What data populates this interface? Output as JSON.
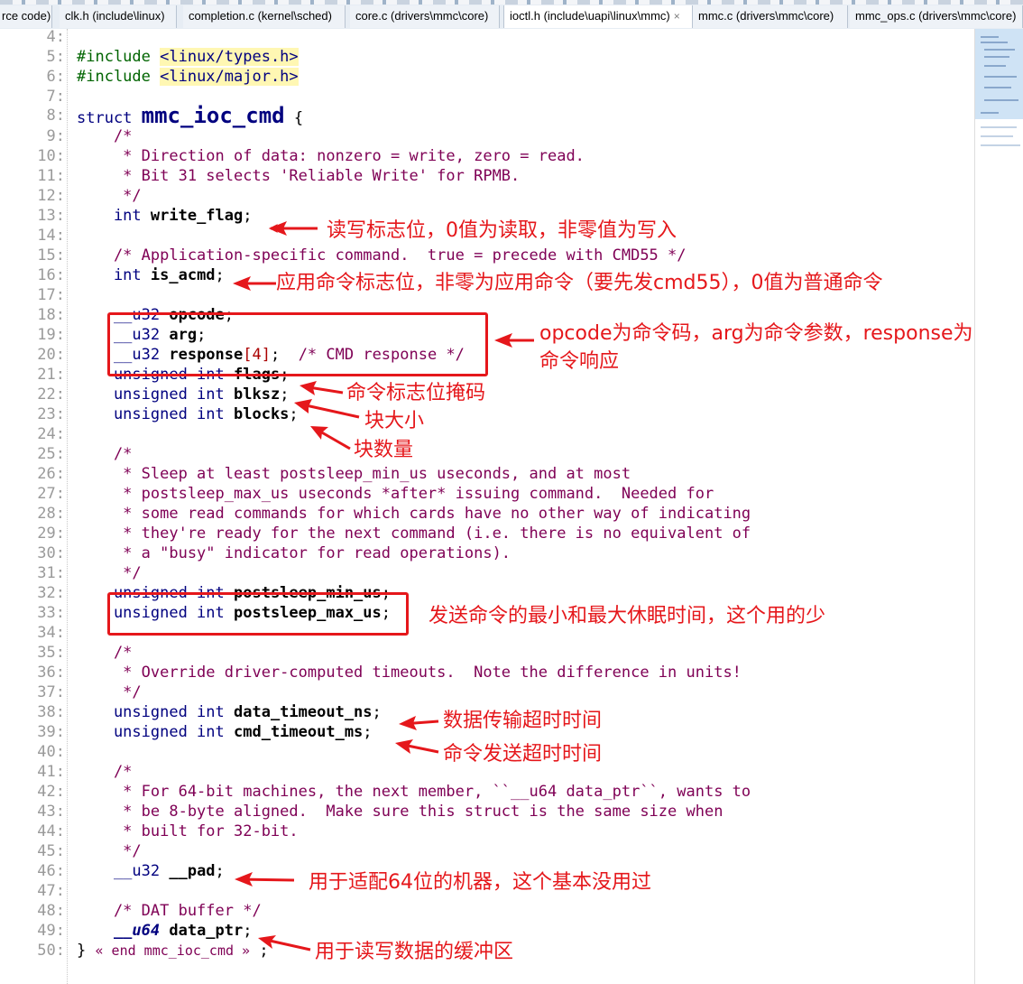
{
  "tabs": [
    {
      "label": "rce code)"
    },
    {
      "label": "clk.h (include\\linux)"
    },
    {
      "label": "completion.c (kernel\\sched)"
    },
    {
      "label": "core.c (drivers\\mmc\\core)"
    },
    {
      "label": "ioctl.h (include\\uapi\\linux\\mmc)",
      "active": true,
      "close": "×"
    },
    {
      "label": "mmc.c (drivers\\mmc\\core)"
    },
    {
      "label": "mmc_ops.c (drivers\\mmc\\core)"
    }
  ],
  "code": {
    "lines": [
      {
        "n": "4:"
      },
      {
        "n": "5:",
        "pp": "#include ",
        "inc": "<linux/types.h>"
      },
      {
        "n": "6:",
        "pp": "#include ",
        "inc": "<linux/major.h>"
      },
      {
        "n": "7:"
      },
      {
        "n": "8:",
        "kw": "struct ",
        "sname": "mmc_ioc_cmd",
        "rest": " {"
      },
      {
        "n": "9:",
        "cm": "    /*"
      },
      {
        "n": "10:",
        "cm": "     * Direction of data: nonzero = write, zero = read."
      },
      {
        "n": "11:",
        "cm": "     * Bit 31 selects 'Reliable Write' for RPMB."
      },
      {
        "n": "12:",
        "cm": "     */"
      },
      {
        "n": "13:",
        "ty": "    int ",
        "bd": "write_flag",
        "rest": ";"
      },
      {
        "n": "14:"
      },
      {
        "n": "15:",
        "cm": "    /* Application-specific command.  true = precede with CMD55 */"
      },
      {
        "n": "16:",
        "ty": "    int ",
        "bd": "is_acmd",
        "rest": ";"
      },
      {
        "n": "17:"
      },
      {
        "n": "18:",
        "ty": "    __u32 ",
        "bd": "opcode",
        "rest": ";"
      },
      {
        "n": "19:",
        "ty": "    __u32 ",
        "bd": "arg",
        "rest": ";"
      },
      {
        "n": "20:",
        "ty": "    __u32 ",
        "bd": "response",
        "nm": "[4]",
        "rest": ";  ",
        "cm2": "/* CMD response */"
      },
      {
        "n": "21:",
        "ty": "    unsigned int ",
        "bd": "flags",
        "rest": ";"
      },
      {
        "n": "22:",
        "ty": "    unsigned int ",
        "bd": "blksz",
        "rest": ";"
      },
      {
        "n": "23:",
        "ty": "    unsigned int ",
        "bd": "blocks",
        "rest": ";"
      },
      {
        "n": "24:"
      },
      {
        "n": "25:",
        "cm": "    /*"
      },
      {
        "n": "26:",
        "cm": "     * Sleep at least postsleep_min_us useconds, and at most"
      },
      {
        "n": "27:",
        "cm": "     * postsleep_max_us useconds *after* issuing command.  Needed for"
      },
      {
        "n": "28:",
        "cm": "     * some read commands for which cards have no other way of indicating"
      },
      {
        "n": "29:",
        "cm": "     * they're ready for the next command (i.e. there is no equivalent of"
      },
      {
        "n": "30:",
        "cm": "     * a \"busy\" indicator for read operations)."
      },
      {
        "n": "31:",
        "cm": "     */"
      },
      {
        "n": "32:",
        "ty": "    unsigned int ",
        "bd": "postsleep_min_us",
        "rest": ";"
      },
      {
        "n": "33:",
        "ty": "    unsigned int ",
        "bd": "postsleep_max_us",
        "rest": ";"
      },
      {
        "n": "34:"
      },
      {
        "n": "35:",
        "cm": "    /*"
      },
      {
        "n": "36:",
        "cm": "     * Override driver-computed timeouts.  Note the difference in units!"
      },
      {
        "n": "37:",
        "cm": "     */"
      },
      {
        "n": "38:",
        "ty": "    unsigned int ",
        "bd": "data_timeout_ns",
        "rest": ";"
      },
      {
        "n": "39:",
        "ty": "    unsigned int ",
        "bd": "cmd_timeout_ms",
        "rest": ";"
      },
      {
        "n": "40:"
      },
      {
        "n": "41:",
        "cm": "    /*"
      },
      {
        "n": "42:",
        "cm": "     * For 64-bit machines, the next member, ``__u64 data_ptr``, wants to"
      },
      {
        "n": "43:",
        "cm": "     * be 8-byte aligned.  Make sure this struct is the same size when"
      },
      {
        "n": "44:",
        "cm": "     * built for 32-bit."
      },
      {
        "n": "45:",
        "cm": "     */"
      },
      {
        "n": "46:",
        "ty": "    __u32 ",
        "bd": "__pad",
        "rest": ";"
      },
      {
        "n": "47:"
      },
      {
        "n": "48:",
        "cm": "    /* DAT buffer */"
      },
      {
        "n": "49:",
        "tyi": "    __u64 ",
        "bd": "data_ptr",
        "rest": ";"
      },
      {
        "n": "50:",
        "rest": "} ",
        "end": "« end mmc_ioc_cmd »",
        "rest2": " ;"
      }
    ]
  },
  "annotations": {
    "write_flag": "读写标志位，0值为读取，非零值为写入",
    "is_acmd": "应用命令标志位，非零为应用命令（要先发cmd55），0值为普通命令",
    "opcode_line1": "opcode为命令码，arg为命令参数，response为",
    "opcode_line2": "命令响应",
    "flags": "命令标志位掩码",
    "blksz": "块大小",
    "blocks": "块数量",
    "postsleep": "发送命令的最小和最大休眠时间，这个用的少",
    "data_timeout": "数据传输超时时间",
    "cmd_timeout": "命令发送超时时间",
    "pad": "用于适配64位的机器，这个基本没用过",
    "data_ptr": "用于读写数据的缓冲区"
  },
  "colors": {
    "annotation": "#e5171b",
    "keyword": "#00007f",
    "comment": "#7f0055"
  }
}
